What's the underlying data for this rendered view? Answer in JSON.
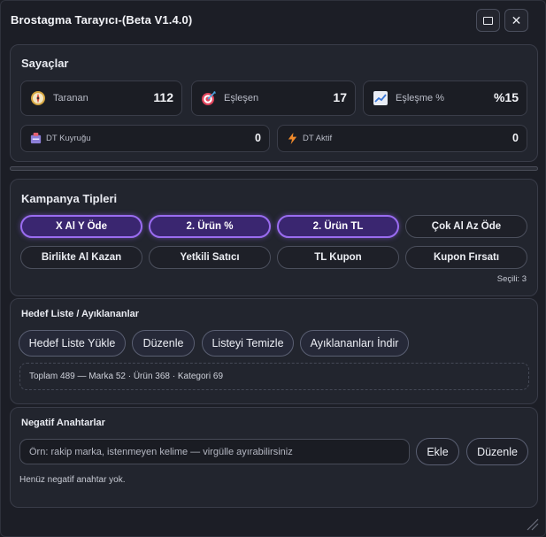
{
  "window": {
    "title": "Brostagma Tarayıcı-(Beta V1.4.0)",
    "maximize_icon": "window-maximize-icon",
    "close_icon": "close-icon",
    "close_glyph": "✕"
  },
  "counters": {
    "title": "Sayaçlar",
    "scanned": {
      "label": "Taranan",
      "value": "112",
      "icon": "compass-icon"
    },
    "matched": {
      "label": "Eşleşen",
      "value": "17",
      "icon": "target-icon"
    },
    "match_rate": {
      "label": "Eşleşme %",
      "value": "%15",
      "icon": "trend-chart-icon"
    },
    "dt_queue": {
      "label": "DT Kuyruğu",
      "value": "0",
      "icon": "queue-box-icon"
    },
    "dt_active": {
      "label": "DT Aktif",
      "value": "0",
      "icon": "lightning-icon"
    }
  },
  "campaign": {
    "title": "Kampanya Tipleri",
    "chips": [
      {
        "label": "X Al Y Öde",
        "selected": true
      },
      {
        "label": "2. Ürün %",
        "selected": true
      },
      {
        "label": "2. Ürün TL",
        "selected": true
      },
      {
        "label": "Çok Al Az Öde",
        "selected": false
      },
      {
        "label": "Birlikte Al Kazan",
        "selected": false
      },
      {
        "label": "Yetkili Satıcı",
        "selected": false
      },
      {
        "label": "TL Kupon",
        "selected": false
      },
      {
        "label": "Kupon Fırsatı",
        "selected": false
      }
    ],
    "selected_count_text": "Seçili: 3",
    "selected_color": "#9a6cf0"
  },
  "target_list": {
    "title": "Hedef Liste / Ayıklananlar",
    "buttons": {
      "load": "Hedef Liste Yükle",
      "edit": "Düzenle",
      "clear": "Listeyi Temizle",
      "download": "Ayıklananları İndir"
    },
    "summary": "Toplam 489 — Marka 52 · Ürün 368 · Kategori 69"
  },
  "negative_keywords": {
    "title": "Negatif Anahtarlar",
    "input_value": "",
    "input_placeholder": "Örn: rakip marka, istenmeyen kelime — virgülle ayırabilirsiniz",
    "add_label": "Ekle",
    "edit_label": "Düzenle",
    "empty_note": "Henüz negatif anahtar yok."
  },
  "colors": {
    "background": "#1c1e26",
    "panel": "#22252e",
    "accent": "#9a6cf0"
  }
}
